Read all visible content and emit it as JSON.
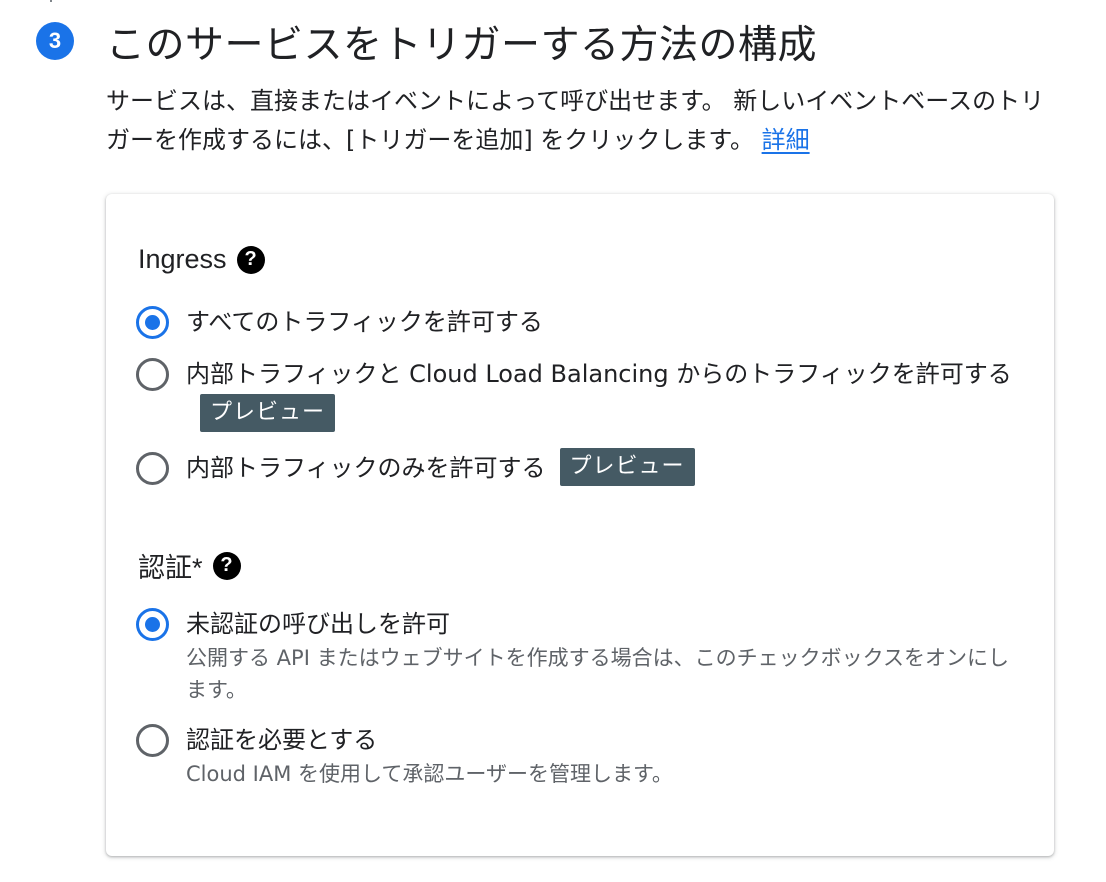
{
  "step": {
    "number": "3",
    "title": "このサービスをトリガーする方法の構成",
    "description": "サービスは、直接またはイベントによって呼び出せます。 新しいイベントベースのトリガーを作成するには、[トリガーを追加] をクリックします。",
    "learn_more": "詳細"
  },
  "ingress": {
    "label": "Ingress",
    "help_icon": "?",
    "options": [
      {
        "label": "すべてのトラフィックを許可する",
        "checked": true,
        "badge": ""
      },
      {
        "label": "内部トラフィックと Cloud Load Balancing からのトラフィックを許可する",
        "checked": false,
        "badge": "プレビュー"
      },
      {
        "label": "内部トラフィックのみを許可する",
        "checked": false,
        "badge": "プレビュー"
      }
    ]
  },
  "auth": {
    "label": "認証*",
    "help_icon": "?",
    "options": [
      {
        "label": "未認証の呼び出しを許可",
        "checked": true,
        "description": "公開する API またはウェブサイトを作成する場合は、このチェックボックスをオンにします。"
      },
      {
        "label": "認証を必要とする",
        "checked": false,
        "description": "Cloud IAM を使用して承認ユーザーを管理します。"
      }
    ]
  },
  "colors": {
    "accent": "#1a73e8",
    "badge_bg": "#455a64",
    "secondary_text": "#5f6368"
  }
}
